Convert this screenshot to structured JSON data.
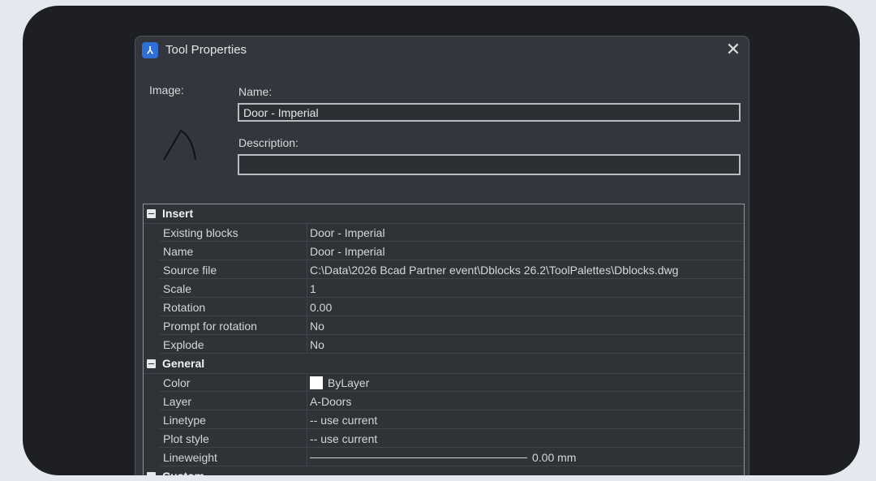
{
  "dialog": {
    "title": "Tool Properties",
    "app_icon": "app-logo-icon",
    "close_icon": "close-icon"
  },
  "image_label": "Image:",
  "name_label": "Name:",
  "name_value": "Door - Imperial",
  "description_label": "Description:",
  "description_value": "",
  "sections": [
    {
      "title": "Insert",
      "rows": [
        {
          "name": "Existing blocks",
          "value": "Door - Imperial"
        },
        {
          "name": "Name",
          "value": "Door - Imperial"
        },
        {
          "name": "Source file",
          "value": "C:\\Data\\2026 Bcad Partner event\\Dblocks 26.2\\ToolPalettes\\Dblocks.dwg"
        },
        {
          "name": "Scale",
          "value": "1"
        },
        {
          "name": "Rotation",
          "value": "0.00"
        },
        {
          "name": "Prompt for rotation",
          "value": "No"
        },
        {
          "name": "Explode",
          "value": "No"
        }
      ]
    },
    {
      "title": "General",
      "rows": [
        {
          "name": "Color",
          "value": "ByLayer",
          "swatch": "#ffffff"
        },
        {
          "name": "Layer",
          "value": "A-Doors"
        },
        {
          "name": "Linetype",
          "value": "-- use current"
        },
        {
          "name": "Plot style",
          "value": "-- use current"
        },
        {
          "name": "Lineweight",
          "value": "0.00 mm"
        }
      ]
    },
    {
      "title": "Custom",
      "rows": []
    }
  ]
}
